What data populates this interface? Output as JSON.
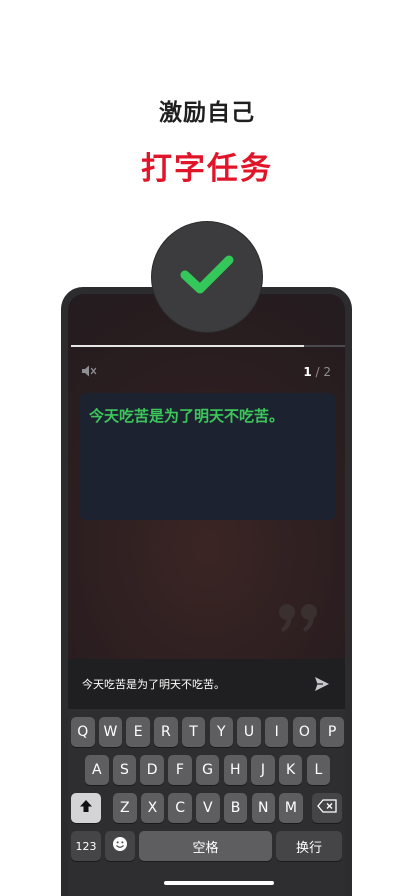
{
  "header": {
    "subtitle": "激励自己",
    "title": "打字任务"
  },
  "colors": {
    "accent_red": "#e0152a",
    "prompt_green": "#3bc75a",
    "badge_check_green": "#34c759"
  },
  "practice": {
    "progress": 0.82,
    "counter_current": "1",
    "counter_total": "/ 2",
    "prompt_text": "今天吃苦是为了明天不吃苦。",
    "input_value": "今天吃苦是为了明天不吃苦。"
  },
  "icons": {
    "badge": "check-icon",
    "sound": "mute-speaker-icon",
    "quote": "quote-icon",
    "send": "send-icon",
    "shift": "shift-icon",
    "emoji": "emoji-icon",
    "backspace": "backspace-icon"
  },
  "keyboard": {
    "row1": [
      "Q",
      "W",
      "E",
      "R",
      "T",
      "Y",
      "U",
      "I",
      "O",
      "P"
    ],
    "row2": [
      "A",
      "S",
      "D",
      "F",
      "G",
      "H",
      "J",
      "K",
      "L"
    ],
    "row3": [
      "Z",
      "X",
      "C",
      "V",
      "B",
      "N",
      "M"
    ],
    "numbers_label": "123",
    "space_label": "空格",
    "return_label": "换行"
  }
}
